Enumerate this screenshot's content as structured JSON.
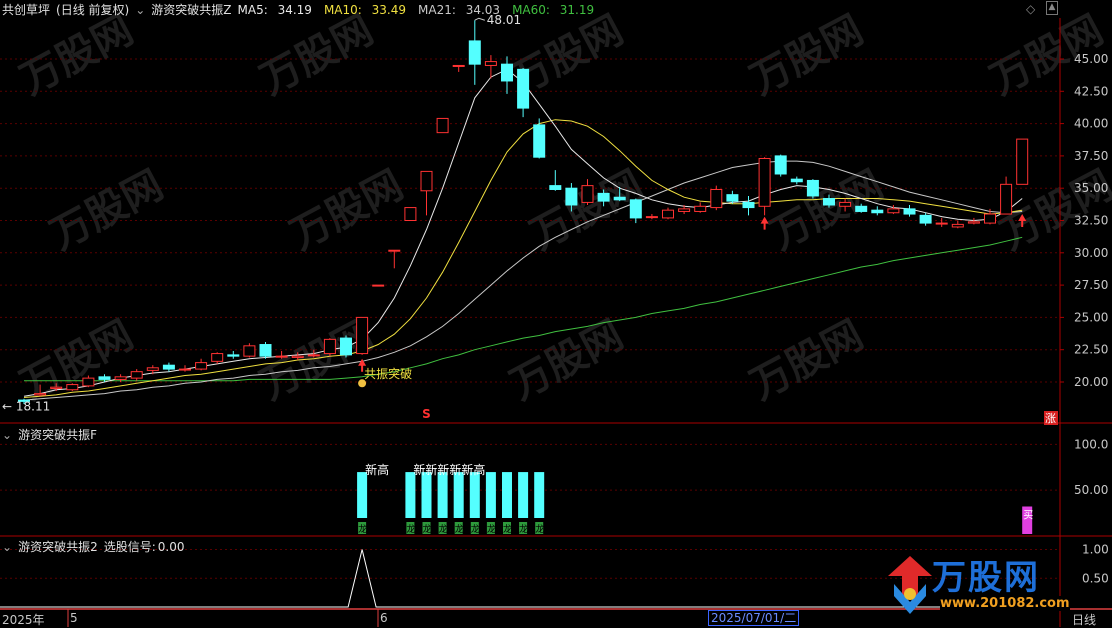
{
  "header_main": {
    "stock": "共创草坪",
    "period": "(日线 前复权)",
    "indicator": "游资突破共振Z",
    "ma": [
      {
        "label": "MA5:",
        "value": "34.19",
        "color": "#e8e8e8"
      },
      {
        "label": "MA10:",
        "value": "33.49",
        "color": "#f0e040"
      },
      {
        "label": "MA21:",
        "value": "34.03",
        "color": "#c8c8c8"
      },
      {
        "label": "MA60:",
        "value": "31.19",
        "color": "#40c040"
      }
    ]
  },
  "header_mid": {
    "indicator": "游资突破共振F"
  },
  "header_bot": {
    "indicator": "游资突破共振2",
    "signal_label": "选股信号:",
    "signal_value": "0.00"
  },
  "main_axis": [
    "45.00",
    "42.50",
    "40.00",
    "37.50",
    "35.00",
    "32.50",
    "30.00",
    "27.50",
    "25.00",
    "22.50",
    "20.00"
  ],
  "mid_axis": [
    "100.0",
    "50.00"
  ],
  "bot_axis": [
    "1.00",
    "0.50"
  ],
  "annotations": {
    "high": "48.01",
    "low": "18.11",
    "breakout": "共振突破",
    "new_high": "新高",
    "new_high_repeat": "新新新新新高",
    "bar_tag": "龙",
    "chart_marker": "S",
    "right_marker": "涨",
    "buy_mark": "买"
  },
  "x_axis": {
    "year": "2025年",
    "m5": "5",
    "m6": "6",
    "cursor_date": "2025/07/01/二",
    "period_label": "日线"
  },
  "watermark": {
    "brand": "万股网",
    "url": "www.201082.com",
    "diag_text": "万股网"
  },
  "colors": {
    "up": "#ff3232",
    "down": "#54ffff",
    "ma5": "#e8e8e8",
    "ma10": "#f0e040",
    "ma21": "#c8c8c8",
    "ma60": "#40c040",
    "axis": "#aa0000",
    "grid": "#5a0000"
  },
  "chart_data": {
    "type": "candlestick",
    "price_axis_range": [
      18.0,
      48.0
    ],
    "candles": [
      [
        18.6,
        18.5,
        18.7,
        18.3
      ],
      [
        19.0,
        19.1,
        19.8,
        18.9
      ],
      [
        19.5,
        19.6,
        19.9,
        19.3
      ],
      [
        19.4,
        19.8,
        19.9,
        19.3
      ],
      [
        19.7,
        20.3,
        20.5,
        19.6
      ],
      [
        20.4,
        20.2,
        20.6,
        20.0
      ],
      [
        20.2,
        20.4,
        20.6,
        20.0
      ],
      [
        20.3,
        20.8,
        21.0,
        20.1
      ],
      [
        20.9,
        21.1,
        21.3,
        20.6
      ],
      [
        21.3,
        21.0,
        21.5,
        20.8
      ],
      [
        21.0,
        21.0,
        21.3,
        20.8
      ],
      [
        21.0,
        21.5,
        21.8,
        20.9
      ],
      [
        21.6,
        22.2,
        22.3,
        21.4
      ],
      [
        22.1,
        22.0,
        22.4,
        21.8
      ],
      [
        22.0,
        22.8,
        23.0,
        21.9
      ],
      [
        22.9,
        22.0,
        23.1,
        21.8
      ],
      [
        22.0,
        22.0,
        22.4,
        21.8
      ],
      [
        21.9,
        22.0,
        22.3,
        21.7
      ],
      [
        22.1,
        22.1,
        22.5,
        21.9
      ],
      [
        22.2,
        23.3,
        23.4,
        22.0
      ],
      [
        23.4,
        22.1,
        23.6,
        21.9
      ],
      [
        22.2,
        25.0,
        25.0,
        22.1
      ],
      [
        27.5,
        27.5,
        27.5,
        27.5
      ],
      [
        30.2,
        30.2,
        30.2,
        28.8
      ],
      [
        32.5,
        33.5,
        33.5,
        32.5
      ],
      [
        34.8,
        36.3,
        36.3,
        32.9
      ],
      [
        39.3,
        40.4,
        40.4,
        39.3
      ],
      [
        44.5,
        44.5,
        44.5,
        44.0
      ],
      [
        46.4,
        44.6,
        48.0,
        43.0
      ],
      [
        44.5,
        44.8,
        45.3,
        43.5
      ],
      [
        44.6,
        43.3,
        45.2,
        42.3
      ],
      [
        44.2,
        41.2,
        44.3,
        40.5
      ],
      [
        39.9,
        37.4,
        40.4,
        37.3
      ],
      [
        35.2,
        34.9,
        36.4,
        34.8
      ],
      [
        35.0,
        33.7,
        35.4,
        33.2
      ],
      [
        33.9,
        35.2,
        35.7,
        33.7
      ],
      [
        34.6,
        34.0,
        34.9,
        33.6
      ],
      [
        34.3,
        34.1,
        35.1,
        34.0
      ],
      [
        34.1,
        32.7,
        34.2,
        32.3
      ],
      [
        32.8,
        32.8,
        33.0,
        32.6
      ],
      [
        32.7,
        33.3,
        33.5,
        32.6
      ],
      [
        33.2,
        33.4,
        33.7,
        33.0
      ],
      [
        33.2,
        33.6,
        33.9,
        33.1
      ],
      [
        33.5,
        34.9,
        35.2,
        33.3
      ],
      [
        34.5,
        34.0,
        34.8,
        33.8
      ],
      [
        33.9,
        33.5,
        34.4,
        32.9
      ],
      [
        33.6,
        37.3,
        37.4,
        32.9
      ],
      [
        37.5,
        36.1,
        37.6,
        35.9
      ],
      [
        35.7,
        35.5,
        35.9,
        35.3
      ],
      [
        35.6,
        34.4,
        35.7,
        34.2
      ],
      [
        34.2,
        33.7,
        34.5,
        33.5
      ],
      [
        33.6,
        33.9,
        34.2,
        33.2
      ],
      [
        33.6,
        33.2,
        33.8,
        33.1
      ],
      [
        33.3,
        33.1,
        33.6,
        32.9
      ],
      [
        33.1,
        33.4,
        33.7,
        33.0
      ],
      [
        33.4,
        33.0,
        33.7,
        32.8
      ],
      [
        32.9,
        32.3,
        33.1,
        32.1
      ],
      [
        32.3,
        32.3,
        32.7,
        32.0
      ],
      [
        32.0,
        32.2,
        32.5,
        31.9
      ],
      [
        32.3,
        32.4,
        32.7,
        32.2
      ],
      [
        32.3,
        33.0,
        33.4,
        32.2
      ],
      [
        33.0,
        35.3,
        35.9,
        33.0
      ],
      [
        35.3,
        38.8,
        38.8,
        35.3
      ]
    ],
    "ma5": [
      18.9,
      19.1,
      19.4,
      19.5,
      19.7,
      20.0,
      20.3,
      20.5,
      20.7,
      20.8,
      21.0,
      21.2,
      21.4,
      21.6,
      21.8,
      21.9,
      22.0,
      22.1,
      22.2,
      22.5,
      22.7,
      23.3,
      24.6,
      26.5,
      29.0,
      31.8,
      35.0,
      38.5,
      42.0,
      43.6,
      44.2,
      43.2,
      41.5,
      39.8,
      38.0,
      36.9,
      35.8,
      35.0,
      34.6,
      34.1,
      33.8,
      33.6,
      33.5,
      33.7,
      33.9,
      34.0,
      34.5,
      34.9,
      35.2,
      35.1,
      34.9,
      34.6,
      34.2,
      33.8,
      33.5,
      33.4,
      33.1,
      32.8,
      32.6,
      32.5,
      32.6,
      33.2,
      34.2
    ],
    "ma10": [
      18.8,
      18.9,
      19.0,
      19.2,
      19.3,
      19.5,
      19.7,
      19.9,
      20.1,
      20.3,
      20.5,
      20.6,
      20.8,
      21.0,
      21.2,
      21.4,
      21.5,
      21.7,
      21.8,
      22.0,
      22.1,
      22.4,
      22.9,
      23.7,
      24.9,
      26.5,
      28.5,
      30.8,
      33.2,
      35.6,
      37.8,
      39.2,
      40.0,
      40.3,
      40.2,
      39.8,
      39.0,
      37.9,
      36.7,
      35.6,
      34.9,
      34.3,
      34.0,
      33.9,
      33.8,
      33.8,
      33.9,
      34.0,
      34.1,
      34.1,
      34.2,
      34.2,
      34.2,
      34.2,
      34.1,
      34.0,
      33.8,
      33.6,
      33.4,
      33.2,
      33.0,
      33.1,
      33.3
    ],
    "ma21": [
      18.6,
      18.7,
      18.8,
      18.9,
      19.0,
      19.1,
      19.3,
      19.4,
      19.6,
      19.7,
      19.9,
      20.0,
      20.2,
      20.3,
      20.5,
      20.6,
      20.8,
      20.9,
      21.1,
      21.2,
      21.4,
      21.6,
      21.9,
      22.3,
      22.8,
      23.5,
      24.3,
      25.3,
      26.4,
      27.5,
      28.6,
      29.6,
      30.5,
      31.2,
      31.8,
      32.4,
      32.9,
      33.4,
      33.9,
      34.4,
      34.9,
      35.4,
      35.8,
      36.2,
      36.6,
      36.8,
      37.0,
      37.1,
      37.1,
      37.0,
      36.7,
      36.3,
      35.9,
      35.5,
      35.1,
      34.7,
      34.4,
      34.1,
      33.8,
      33.5,
      33.2,
      33.1,
      33.2
    ],
    "ma60": [
      20.1,
      20.1,
      20.1,
      20.1,
      20.1,
      20.1,
      20.1,
      20.1,
      20.1,
      20.1,
      20.1,
      20.1,
      20.1,
      20.1,
      20.2,
      20.2,
      20.2,
      20.2,
      20.2,
      20.2,
      20.3,
      20.4,
      20.6,
      20.8,
      21.1,
      21.4,
      21.8,
      22.1,
      22.5,
      22.8,
      23.1,
      23.4,
      23.6,
      23.9,
      24.1,
      24.3,
      24.6,
      24.8,
      25.0,
      25.3,
      25.5,
      25.7,
      26.0,
      26.2,
      26.5,
      26.8,
      27.1,
      27.4,
      27.7,
      28.0,
      28.3,
      28.6,
      28.9,
      29.1,
      29.4,
      29.6,
      29.8,
      30.0,
      30.2,
      30.4,
      30.6,
      30.9,
      31.2
    ],
    "f_indicator": {
      "range": [
        0,
        120
      ],
      "spike_index": 62,
      "spike_value": 20,
      "new_high_bars": [
        21,
        24,
        25,
        26,
        27,
        28,
        29,
        30,
        31,
        32
      ],
      "new_high_value": 61
    },
    "signal": {
      "range": [
        0,
        1.2
      ],
      "spike_index": 21,
      "spike_value": 1.0
    }
  }
}
